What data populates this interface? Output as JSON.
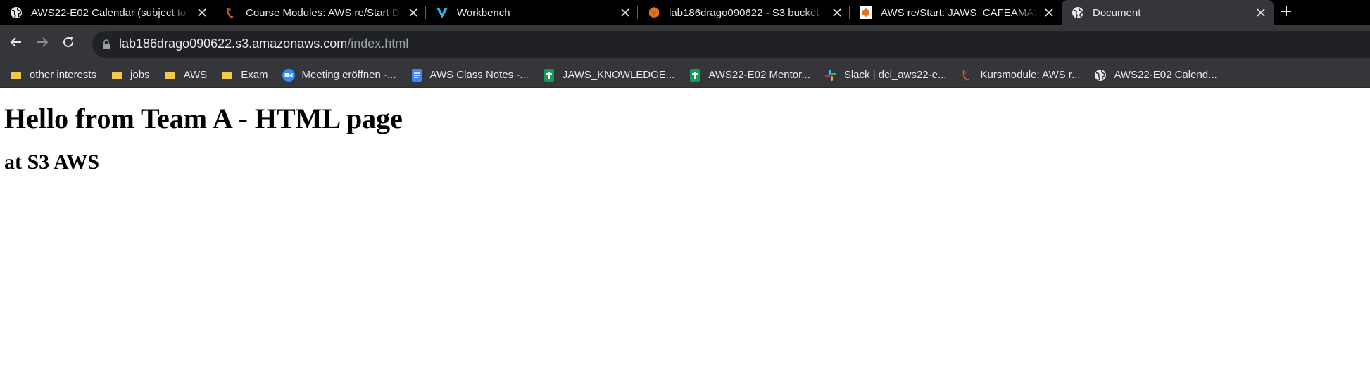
{
  "browser": {
    "tabs": [
      {
        "title": "AWS22-E02 Calendar (subject to",
        "icon": "globe-icon",
        "active": false
      },
      {
        "title": "Course Modules: AWS re/Start DE",
        "icon": "canvas-icon",
        "active": false
      },
      {
        "title": "Workbench",
        "icon": "vocareum-icon",
        "active": false
      },
      {
        "title": "lab186drago090622 - S3 bucket",
        "icon": "aws-cube-icon",
        "active": false
      },
      {
        "title": "AWS re/Start: JAWS_CAFEAMAZO",
        "icon": "aws-cube-icon",
        "active": false
      },
      {
        "title": "Document",
        "icon": "globe-icon",
        "active": true
      }
    ],
    "address": {
      "host": "lab186drago090622.s3.amazonaws.com",
      "path": "/index.html"
    },
    "bookmarks": [
      {
        "label": "other interests",
        "icon": "folder-icon"
      },
      {
        "label": "jobs",
        "icon": "folder-icon"
      },
      {
        "label": "AWS",
        "icon": "folder-icon"
      },
      {
        "label": "Exam",
        "icon": "folder-icon"
      },
      {
        "label": "Meeting eröffnen -...",
        "icon": "zoom-icon"
      },
      {
        "label": "AWS Class Notes -...",
        "icon": "google-docs-icon"
      },
      {
        "label": "JAWS_KNOWLEDGE...",
        "icon": "google-sheets-icon"
      },
      {
        "label": "AWS22-E02 Mentor...",
        "icon": "google-sheets-icon"
      },
      {
        "label": "Slack | dci_aws22-e...",
        "icon": "slack-icon"
      },
      {
        "label": "Kursmodule: AWS r...",
        "icon": "canvas-icon"
      },
      {
        "label": "AWS22-E02 Calend...",
        "icon": "globe-icon"
      }
    ],
    "colors": {
      "tabstrip": "#000000",
      "toolbar": "#35363a",
      "omnibox": "#202124",
      "text": "#e8eaed"
    }
  },
  "page": {
    "heading": "Hello from Team A - HTML page",
    "subheading": "at S3 AWS"
  }
}
